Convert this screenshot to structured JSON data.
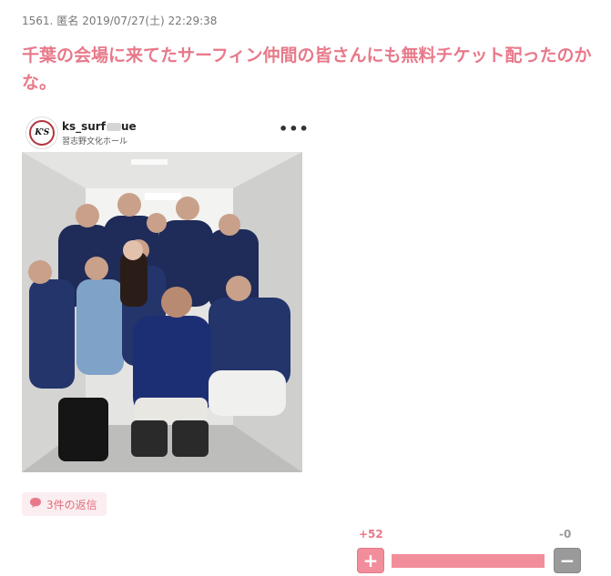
{
  "comment": {
    "number": "1561.",
    "author": "匿名",
    "datetime": "2019/07/27(土) 22:29:38",
    "body": "千葉の会場に来てたサーフィン仲間の皆さんにも無料チケット配ったのかな。"
  },
  "embed": {
    "account_name": "ks_surf",
    "account_name_tail": "ue",
    "location": "習志野文化ホール",
    "logo_text": "K'S",
    "more_icon": "•••"
  },
  "replies": {
    "label": "3件の返信",
    "icon": "speech-bubble-icon"
  },
  "votes": {
    "plus_label": "+52",
    "minus_label": "-0",
    "plus_ratio": 1.0,
    "plus_glyph": "+",
    "minus_glyph": "−"
  },
  "colors": {
    "accent": "#e8798a",
    "plus": "#f28d9b",
    "minus": "#9a9a9a"
  }
}
